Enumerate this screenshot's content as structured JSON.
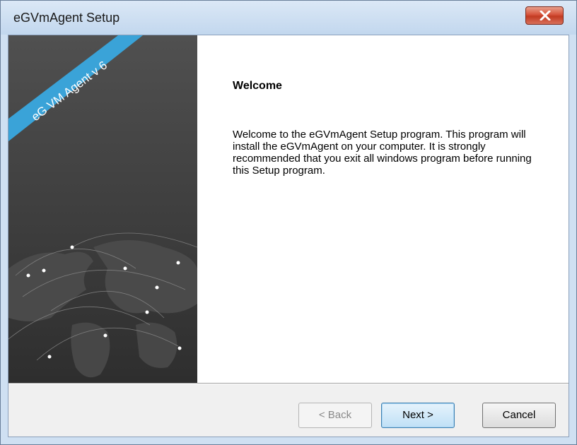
{
  "window": {
    "title": "eGVmAgent Setup",
    "close_icon": "close-icon"
  },
  "banner": {
    "ribbon_text": "eG VM Agent v 6",
    "image": "world-map-graphic"
  },
  "content": {
    "heading": "Welcome",
    "body": "Welcome to the eGVmAgent Setup program. This program will install the eGVmAgent on your computer. It is strongly recommended that you exit all windows program before running this Setup program."
  },
  "buttons": {
    "back": "< Back",
    "next": "Next >",
    "cancel": "Cancel"
  },
  "colors": {
    "ribbon": "#3aa3d8",
    "panel_bg": "#3c3c3c",
    "default_button_border": "#3c7fb1"
  }
}
